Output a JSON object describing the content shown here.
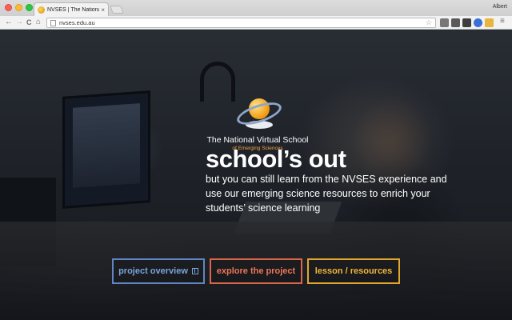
{
  "browser": {
    "tab_title": "NVSES | The National Virtu",
    "tab_close": "×",
    "profile_name": "Albert",
    "url": "nvses.edu.au",
    "nav": {
      "back": "←",
      "forward": "→",
      "reload": "C",
      "home": "⌂"
    },
    "star": "☆",
    "menu": "≡",
    "extension_colors": [
      "#777777",
      "#5a5a5a",
      "#3d3d3d",
      "#3b6fd8",
      "#e8b53e",
      "#ee6b3a"
    ]
  },
  "logo": {
    "title": "The National Virtual School",
    "subtitle": "of Emerging Sciences",
    "colors": {
      "ring": "#8fa6c9",
      "ball": "#f4a21c",
      "subtitle": "#f2a640"
    }
  },
  "hero": {
    "headline": "school’s out",
    "tagline": "but you can still learn from the NVSES experience and use our emerging science resources to enrich your students’ science learning"
  },
  "buttons": [
    {
      "label": "project overview",
      "color": "#7aa3dd",
      "icon": "film-icon"
    },
    {
      "label": "explore the project",
      "color": "#ee7458"
    },
    {
      "label": "lesson / resources",
      "color": "#f3b43a"
    }
  ]
}
